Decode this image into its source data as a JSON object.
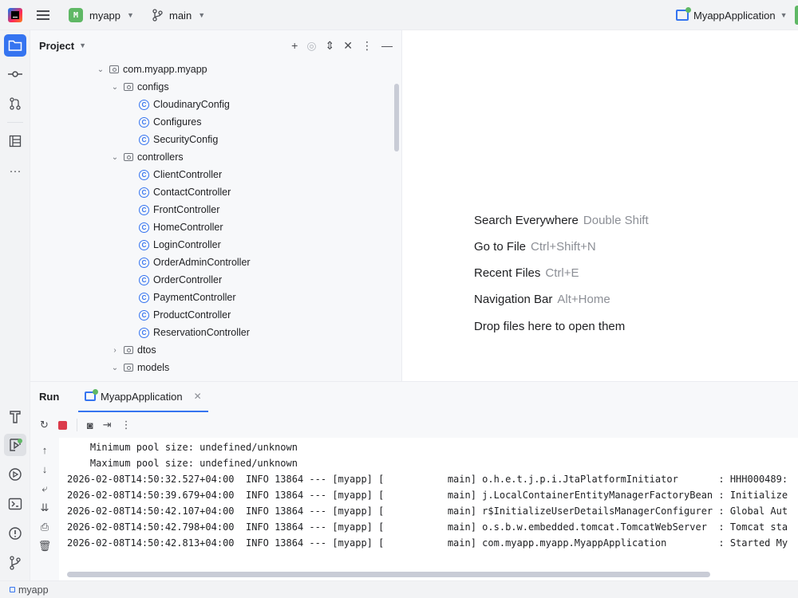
{
  "topbar": {
    "project_badge": "M",
    "project_name": "myapp",
    "branch": "main",
    "run_config": "MyappApplication"
  },
  "project_panel": {
    "title": "Project",
    "tree": [
      {
        "label": "com.myapp.myapp",
        "kind": "package",
        "expanded": true
      },
      {
        "label": "configs",
        "kind": "package",
        "expanded": true
      },
      {
        "label": "CloudinaryConfig",
        "kind": "class"
      },
      {
        "label": "Configures",
        "kind": "class"
      },
      {
        "label": "SecurityConfig",
        "kind": "class"
      },
      {
        "label": "controllers",
        "kind": "package",
        "expanded": true
      },
      {
        "label": "ClientController",
        "kind": "class"
      },
      {
        "label": "ContactController",
        "kind": "class"
      },
      {
        "label": "FrontController",
        "kind": "class"
      },
      {
        "label": "HomeController",
        "kind": "class"
      },
      {
        "label": "LoginController",
        "kind": "class"
      },
      {
        "label": "OrderAdminController",
        "kind": "class"
      },
      {
        "label": "OrderController",
        "kind": "class"
      },
      {
        "label": "PaymentController",
        "kind": "class"
      },
      {
        "label": "ProductController",
        "kind": "class"
      },
      {
        "label": "ReservationController",
        "kind": "class"
      },
      {
        "label": "dtos",
        "kind": "package",
        "expanded": false
      },
      {
        "label": "models",
        "kind": "package",
        "expanded": true
      }
    ]
  },
  "editor_hints": [
    {
      "label": "Search Everywhere",
      "shortcut": "Double Shift"
    },
    {
      "label": "Go to File",
      "shortcut": "Ctrl+Shift+N"
    },
    {
      "label": "Recent Files",
      "shortcut": "Ctrl+E"
    },
    {
      "label": "Navigation Bar",
      "shortcut": "Alt+Home"
    },
    {
      "label": "Drop files here to open them",
      "shortcut": ""
    }
  ],
  "run_panel": {
    "label": "Run",
    "tab": "MyappApplication",
    "console_lines": [
      "    Minimum pool size: undefined/unknown",
      "    Maximum pool size: undefined/unknown",
      "2026-02-08T14:50:32.527+04:00  INFO 13864 --- [myapp] [           main] o.h.e.t.j.p.i.JtaPlatformInitiator       : HHH000489:",
      "2026-02-08T14:50:39.679+04:00  INFO 13864 --- [myapp] [           main] j.LocalContainerEntityManagerFactoryBean : Initialize",
      "2026-02-08T14:50:42.107+04:00  INFO 13864 --- [myapp] [           main] r$InitializeUserDetailsManagerConfigurer : Global Aut",
      "2026-02-08T14:50:42.798+04:00  INFO 13864 --- [myapp] [           main] o.s.b.w.embedded.tomcat.TomcatWebServer  : Tomcat sta",
      "2026-02-08T14:50:42.813+04:00  INFO 13864 --- [myapp] [           main] com.myapp.myapp.MyappApplication         : Started My"
    ]
  },
  "status_bar": {
    "project": "myapp"
  },
  "colors": {
    "accent": "#3574f0",
    "run_green": "#5fb865",
    "stop_red": "#db3b4b"
  }
}
